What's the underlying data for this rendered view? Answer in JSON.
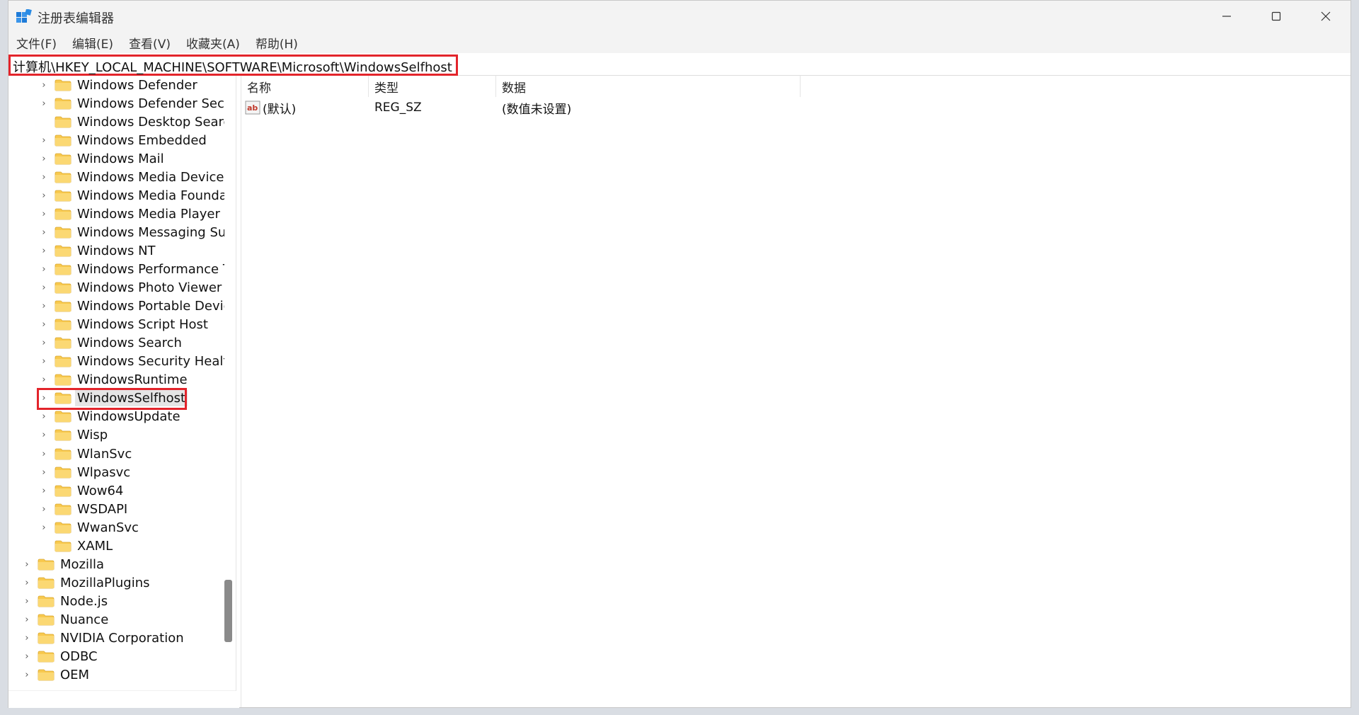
{
  "window": {
    "title": "注册表编辑器"
  },
  "menu": [
    "文件(F)",
    "编辑(E)",
    "查看(V)",
    "收藏夹(A)",
    "帮助(H)"
  ],
  "address": "计算机\\HKEY_LOCAL_MACHINE\\SOFTWARE\\Microsoft\\WindowsSelfhost",
  "tree": {
    "items": [
      {
        "label": "Windows Defender",
        "level": 2,
        "expandable": true
      },
      {
        "label": "Windows Defender Secu",
        "level": 2,
        "expandable": true
      },
      {
        "label": "Windows Desktop Searcl",
        "level": 2,
        "expandable": false
      },
      {
        "label": "Windows Embedded",
        "level": 2,
        "expandable": true
      },
      {
        "label": "Windows Mail",
        "level": 2,
        "expandable": true
      },
      {
        "label": "Windows Media Device I",
        "level": 2,
        "expandable": true
      },
      {
        "label": "Windows Media Founda",
        "level": 2,
        "expandable": true
      },
      {
        "label": "Windows Media Player N",
        "level": 2,
        "expandable": true
      },
      {
        "label": "Windows Messaging Sub",
        "level": 2,
        "expandable": true
      },
      {
        "label": "Windows NT",
        "level": 2,
        "expandable": true
      },
      {
        "label": "Windows Performance T",
        "level": 2,
        "expandable": true
      },
      {
        "label": "Windows Photo Viewer",
        "level": 2,
        "expandable": true
      },
      {
        "label": "Windows Portable Devic",
        "level": 2,
        "expandable": true
      },
      {
        "label": "Windows Script Host",
        "level": 2,
        "expandable": true
      },
      {
        "label": "Windows Search",
        "level": 2,
        "expandable": true
      },
      {
        "label": "Windows Security Healtl",
        "level": 2,
        "expandable": true
      },
      {
        "label": "WindowsRuntime",
        "level": 2,
        "expandable": true
      },
      {
        "label": "WindowsSelfhost",
        "level": 2,
        "expandable": true,
        "selected": true
      },
      {
        "label": "WindowsUpdate",
        "level": 2,
        "expandable": true
      },
      {
        "label": "Wisp",
        "level": 2,
        "expandable": true
      },
      {
        "label": "WlanSvc",
        "level": 2,
        "expandable": true
      },
      {
        "label": "Wlpasvc",
        "level": 2,
        "expandable": true
      },
      {
        "label": "Wow64",
        "level": 2,
        "expandable": true
      },
      {
        "label": "WSDAPI",
        "level": 2,
        "expandable": true
      },
      {
        "label": "WwanSvc",
        "level": 2,
        "expandable": true
      },
      {
        "label": "XAML",
        "level": 2,
        "expandable": false
      },
      {
        "label": "Mozilla",
        "level": 1,
        "expandable": true
      },
      {
        "label": "MozillaPlugins",
        "level": 1,
        "expandable": true
      },
      {
        "label": "Node.js",
        "level": 1,
        "expandable": true
      },
      {
        "label": "Nuance",
        "level": 1,
        "expandable": true
      },
      {
        "label": "NVIDIA Corporation",
        "level": 1,
        "expandable": true
      },
      {
        "label": "ODBC",
        "level": 1,
        "expandable": true
      },
      {
        "label": "OEM",
        "level": 1,
        "expandable": true
      }
    ]
  },
  "list": {
    "columns": [
      "名称",
      "类型",
      "数据"
    ],
    "rows": [
      {
        "name": "(默认)",
        "type": "REG_SZ",
        "data": "(数值未设置)",
        "icon": "string-value-icon"
      }
    ]
  },
  "colors": {
    "highlight": "#e3242b",
    "folder": "#f8c94e",
    "selection": "#e5e5e5"
  }
}
